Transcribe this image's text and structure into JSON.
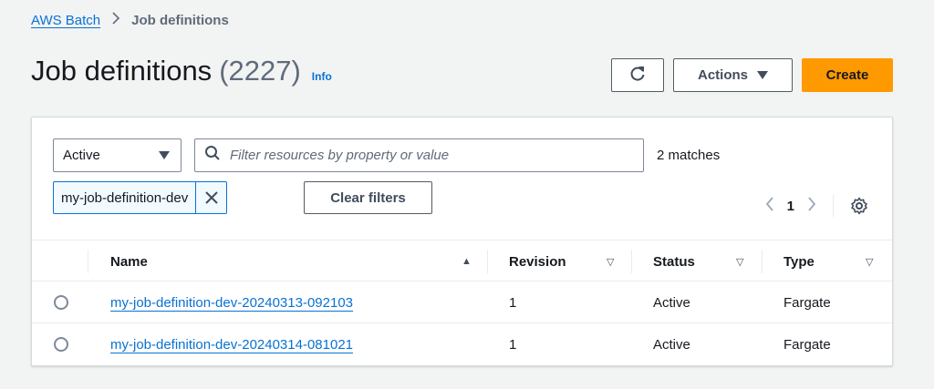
{
  "breadcrumb": {
    "root": "AWS Batch",
    "current": "Job definitions"
  },
  "header": {
    "title": "Job definitions",
    "count": "(2227)",
    "info": "Info"
  },
  "actions": {
    "actions_label": "Actions",
    "create_label": "Create"
  },
  "filters": {
    "status_select": "Active",
    "search_placeholder": "Filter resources by property or value",
    "matches": "2 matches",
    "token": "my-job-definition-dev",
    "clear_label": "Clear filters"
  },
  "pagination": {
    "current_page": "1"
  },
  "table": {
    "columns": [
      "Name",
      "Revision",
      "Status",
      "Type"
    ],
    "rows": [
      {
        "name": "my-job-definition-dev-20240313-092103",
        "revision": "1",
        "status": "Active",
        "type": "Fargate"
      },
      {
        "name": "my-job-definition-dev-20240314-081021",
        "revision": "1",
        "status": "Active",
        "type": "Fargate"
      }
    ]
  }
}
